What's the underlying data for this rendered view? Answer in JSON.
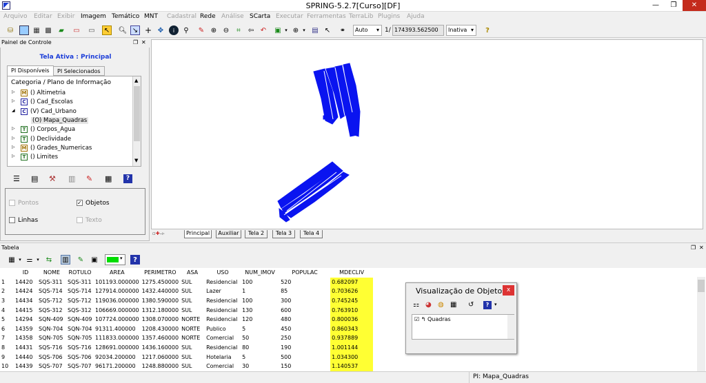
{
  "window": {
    "title": "SPRING-5.2.7[Curso][DF]",
    "minimize": "—",
    "restore": "❐",
    "close": "✕"
  },
  "menu": [
    {
      "label": "Arquivo",
      "enabled": false
    },
    {
      "label": "Editar",
      "enabled": false
    },
    {
      "label": "Exibir",
      "enabled": false
    },
    {
      "label": "Imagem",
      "enabled": true
    },
    {
      "label": "Temático",
      "enabled": true
    },
    {
      "label": "MNT",
      "enabled": true
    },
    {
      "label": "Cadastral",
      "enabled": false
    },
    {
      "label": "Rede",
      "enabled": true
    },
    {
      "label": "Análise",
      "enabled": false
    },
    {
      "label": "SCarta",
      "enabled": true
    },
    {
      "label": "Executar",
      "enabled": false
    },
    {
      "label": "Ferramentas",
      "enabled": false
    },
    {
      "label": "TerraLib",
      "enabled": false
    },
    {
      "label": "Plugins",
      "enabled": false
    },
    {
      "label": "Ajuda",
      "enabled": false
    }
  ],
  "toolbar": {
    "scale_mode": "Auto",
    "scale_prefix": "1/",
    "scale_value": "174393.562500",
    "state": "Inativa",
    "help_icon": "?"
  },
  "panel": {
    "header": "Painel de Controle",
    "active_view": "Tela Ativa : Principal",
    "tabs": [
      "PI Disponíveis",
      "PI Selecionados"
    ],
    "tree_header": "Categoria / Plano de Informação",
    "tree": [
      {
        "badge": "M",
        "label": "() Altimetria",
        "expander": "▷",
        "badge_color": "#a07000"
      },
      {
        "badge": "C",
        "label": "() Cad_Escolas",
        "expander": "▷",
        "badge_color": "#2020a0"
      },
      {
        "badge": "C",
        "label": "(V) Cad_Urbano",
        "expander": "◢",
        "badge_color": "#2020a0"
      },
      {
        "badge": "",
        "label": "(O) Mapa_Quadras",
        "expander": "",
        "badge_color": ""
      },
      {
        "badge": "T",
        "label": "() Corpos_Agua",
        "expander": "▷",
        "badge_color": "#207020"
      },
      {
        "badge": "T",
        "label": "() Declividade",
        "expander": "▷",
        "badge_color": "#207020"
      },
      {
        "badge": "M",
        "label": "() Grades_Numericas",
        "expander": "▷",
        "badge_color": "#a07000"
      },
      {
        "badge": "T",
        "label": "() Limites",
        "expander": "▷",
        "badge_color": "#207020"
      }
    ],
    "display": {
      "pontos": "Pontos",
      "objetos": "Objetos",
      "linhas": "Linhas",
      "texto": "Texto"
    }
  },
  "canvas_tabs": [
    "Principal",
    "Auxiliar",
    "Tela 2",
    "Tela 3",
    "Tela 4"
  ],
  "map_color": "#0a14f0",
  "table": {
    "header": "Tabela",
    "highlight": "#ffff33",
    "columns": [
      "",
      "ID",
      "NOME",
      "ROTULO",
      "AREA",
      "PERIMETRO",
      "ASA",
      "USO",
      "NUM_IMOV",
      "POPULAC",
      "MDECLIV"
    ],
    "rows": [
      [
        "1",
        "14420",
        "SQS-311",
        "SQS-311",
        "101193.000000",
        "1275.450000",
        "SUL",
        "Residencial",
        "100",
        "520",
        "0.682097"
      ],
      [
        "2",
        "14424",
        "SQS-714",
        "SQS-714",
        "127914.000000",
        "1432.440000",
        "SUL",
        "Lazer",
        "1",
        "85",
        "0.703626"
      ],
      [
        "3",
        "14434",
        "SQS-712",
        "SQS-712",
        "119036.000000",
        "1380.590000",
        "SUL",
        "Residencial",
        "100",
        "300",
        "0.745245"
      ],
      [
        "4",
        "14415",
        "SQS-312",
        "SQS-312",
        "106669.000000",
        "1312.180000",
        "SUL",
        "Residencial",
        "130",
        "600",
        "0.763910"
      ],
      [
        "5",
        "14294",
        "SQN-409",
        "SQN-409",
        "107724.000000",
        "1308.070000",
        "NORTE",
        "Residencial",
        "120",
        "480",
        "0.800036"
      ],
      [
        "6",
        "14359",
        "SQN-704",
        "SQN-704",
        "91311.400000",
        "1208.430000",
        "NORTE",
        "Publico",
        "5",
        "450",
        "0.860343"
      ],
      [
        "7",
        "14358",
        "SQN-705",
        "SQN-705",
        "111833.000000",
        "1357.460000",
        "NORTE",
        "Comercial",
        "50",
        "250",
        "0.937889"
      ],
      [
        "8",
        "14431",
        "SQS-716",
        "SQS-716",
        "128691.000000",
        "1436.160000",
        "SUL",
        "Residencial",
        "80",
        "190",
        "1.001144"
      ],
      [
        "9",
        "14440",
        "SQS-706",
        "SQS-706",
        "92034.200000",
        "1217.060000",
        "SUL",
        "Hotelaria",
        "5",
        "500",
        "1.034300"
      ],
      [
        "10",
        "14439",
        "SQS-707",
        "SQS-707",
        "96171.200000",
        "1248.880000",
        "SUL",
        "Comercial",
        "30",
        "150",
        "1.140537"
      ]
    ]
  },
  "objects_window": {
    "title": "Visualização de Objetos",
    "close": "x",
    "item": "Quadras",
    "help": "?"
  },
  "status": {
    "text": "PI: Mapa_Quadras"
  }
}
